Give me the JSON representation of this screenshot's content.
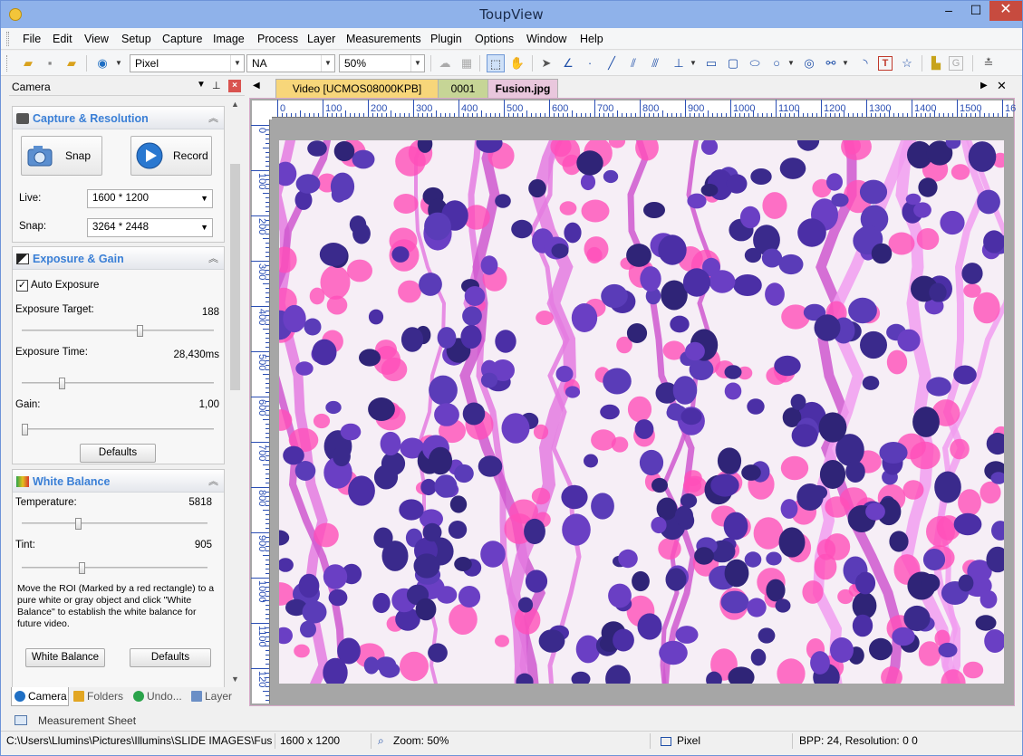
{
  "window": {
    "title": "ToupView",
    "minimize": "–",
    "maximize": "☐",
    "close": "✕"
  },
  "menu": [
    "File",
    "Edit",
    "View",
    "Setup",
    "Capture",
    "Image",
    "Process",
    "Layer",
    "Measurements",
    "Plugin",
    "Options",
    "Window",
    "Help"
  ],
  "toolbar": {
    "unit": "Pixel",
    "calibration": "NA",
    "zoom": "50%"
  },
  "panel": {
    "title": "Camera",
    "capture": {
      "title": "Capture & Resolution",
      "snap": "Snap",
      "record": "Record",
      "live_label": "Live:",
      "live_value": "1600 * 1200",
      "snap_label": "Snap:",
      "snap_value": "3264 * 2448"
    },
    "exposure": {
      "title": "Exposure & Gain",
      "auto": "Auto Exposure",
      "auto_checked": true,
      "target_label": "Exposure Target:",
      "target_value": "188",
      "target_level": 0.62,
      "time_label": "Exposure Time:",
      "time_value": "28,430ms",
      "time_level": 0.2,
      "gain_label": "Gain:",
      "gain_value": "1,00",
      "gain_level": 0.0,
      "defaults": "Defaults"
    },
    "wb": {
      "title": "White Balance",
      "temp_label": "Temperature:",
      "temp_value": "5818",
      "temp_level": 0.3,
      "tint_label": "Tint:",
      "tint_value": "905",
      "tint_level": 0.32,
      "help": "Move the ROI (Marked by a red rectangle) to a pure white or gray object and click \"White Balance\" to establish the white balance for future video.",
      "wb_button": "White Balance",
      "defaults": "Defaults"
    }
  },
  "bottom_tabs": [
    "Camera",
    "Folders",
    "Undo...",
    "Layer"
  ],
  "measurement_sheet": "Measurement Sheet",
  "doc_tabs": [
    "Video [UCMOS08000KPB]",
    "0001",
    "Fusion.jpg"
  ],
  "ruler_h": [
    "0",
    "100",
    "200",
    "300",
    "400",
    "500",
    "600",
    "700",
    "800",
    "900",
    "1000",
    "1100",
    "1200",
    "1300",
    "1400",
    "1500",
    "16"
  ],
  "ruler_v": [
    "0",
    "100",
    "200",
    "300",
    "400",
    "500",
    "600",
    "700",
    "800",
    "900",
    "1000",
    "1100",
    "120"
  ],
  "status": {
    "path": "C:\\Users\\Llumins\\Pictures\\Illumins\\SLIDE IMAGES\\Fusi",
    "size": "1600 x 1200",
    "zoom": "Zoom: 50%",
    "unit": "Pixel",
    "bpp": "BPP: 24, Resolution: 0 0"
  },
  "colors": {
    "accent": "#3a7fd6",
    "tab_video": "#f7d67a",
    "tab_0001": "#c6d596",
    "tab_fusion": "#e9c7dd"
  }
}
